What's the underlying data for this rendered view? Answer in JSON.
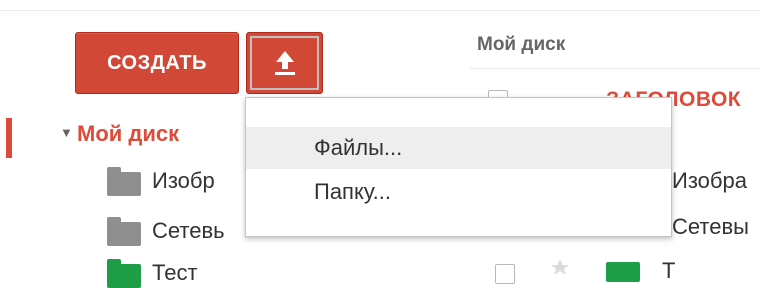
{
  "toolbar": {
    "create_label": "СОЗДАТЬ",
    "upload_icon": "upload-arrow-icon"
  },
  "breadcrumb": "Мой диск",
  "list_header": {
    "title_partial": "ЗАГОЛОВОК"
  },
  "tree": {
    "root_label": "Мой диск",
    "items": [
      {
        "label": "Изобр",
        "folder_color": "#8f8f8f"
      },
      {
        "label": "Сетевь",
        "folder_color": "#8f8f8f"
      },
      {
        "label": "Тест",
        "folder_color": "#1e9e47"
      }
    ]
  },
  "list": {
    "items": [
      {
        "label": "Изобра"
      },
      {
        "label": "Сетевы"
      },
      {
        "label": "Т"
      }
    ]
  },
  "upload_menu": {
    "items": [
      {
        "label": "Файлы..."
      },
      {
        "label": "Папку..."
      }
    ]
  },
  "colors": {
    "accent": "#d14836",
    "title_red": "#dd4b39",
    "folder_gray": "#8f8f8f",
    "folder_green": "#1e9e47"
  }
}
